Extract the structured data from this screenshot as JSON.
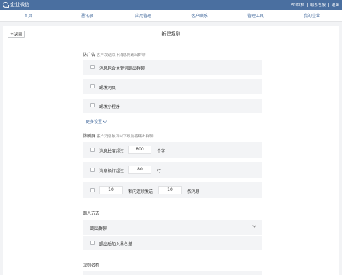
{
  "topbar": {
    "logo_text": "企业微信",
    "links": [
      "API文档",
      "联系客服",
      "退出"
    ]
  },
  "nav": {
    "items": [
      "首页",
      "通讯录",
      "应用管理",
      "客户联系",
      "管理工具",
      "我的企业"
    ]
  },
  "page": {
    "back_label": "返回",
    "title": "新建规则"
  },
  "ad_section": {
    "title": "防广告",
    "hint": "客户发送以下消息将踢出群聊",
    "options": [
      "消息包含关键词踢出群聊",
      "踢发网页",
      "踢发小程序"
    ],
    "more_label": "更多设置"
  },
  "spam_section": {
    "title": "防刷屏",
    "hint": "客户消息触发以下规则将踢出群聊",
    "length_label": "消息长度超过",
    "length_value": "800",
    "length_unit": "个字",
    "lines_label": "消息换行超过",
    "lines_value": "80",
    "lines_unit": "行",
    "seconds_value": "10",
    "seconds_text": "秒内连续发送",
    "count_value": "10",
    "count_unit": "条消息"
  },
  "kick_section": {
    "title": "踢人方式",
    "selected": "踢出群聊",
    "blacklist_label": "踢出后加入黑名单"
  },
  "name_section": {
    "title": "规则名称"
  }
}
